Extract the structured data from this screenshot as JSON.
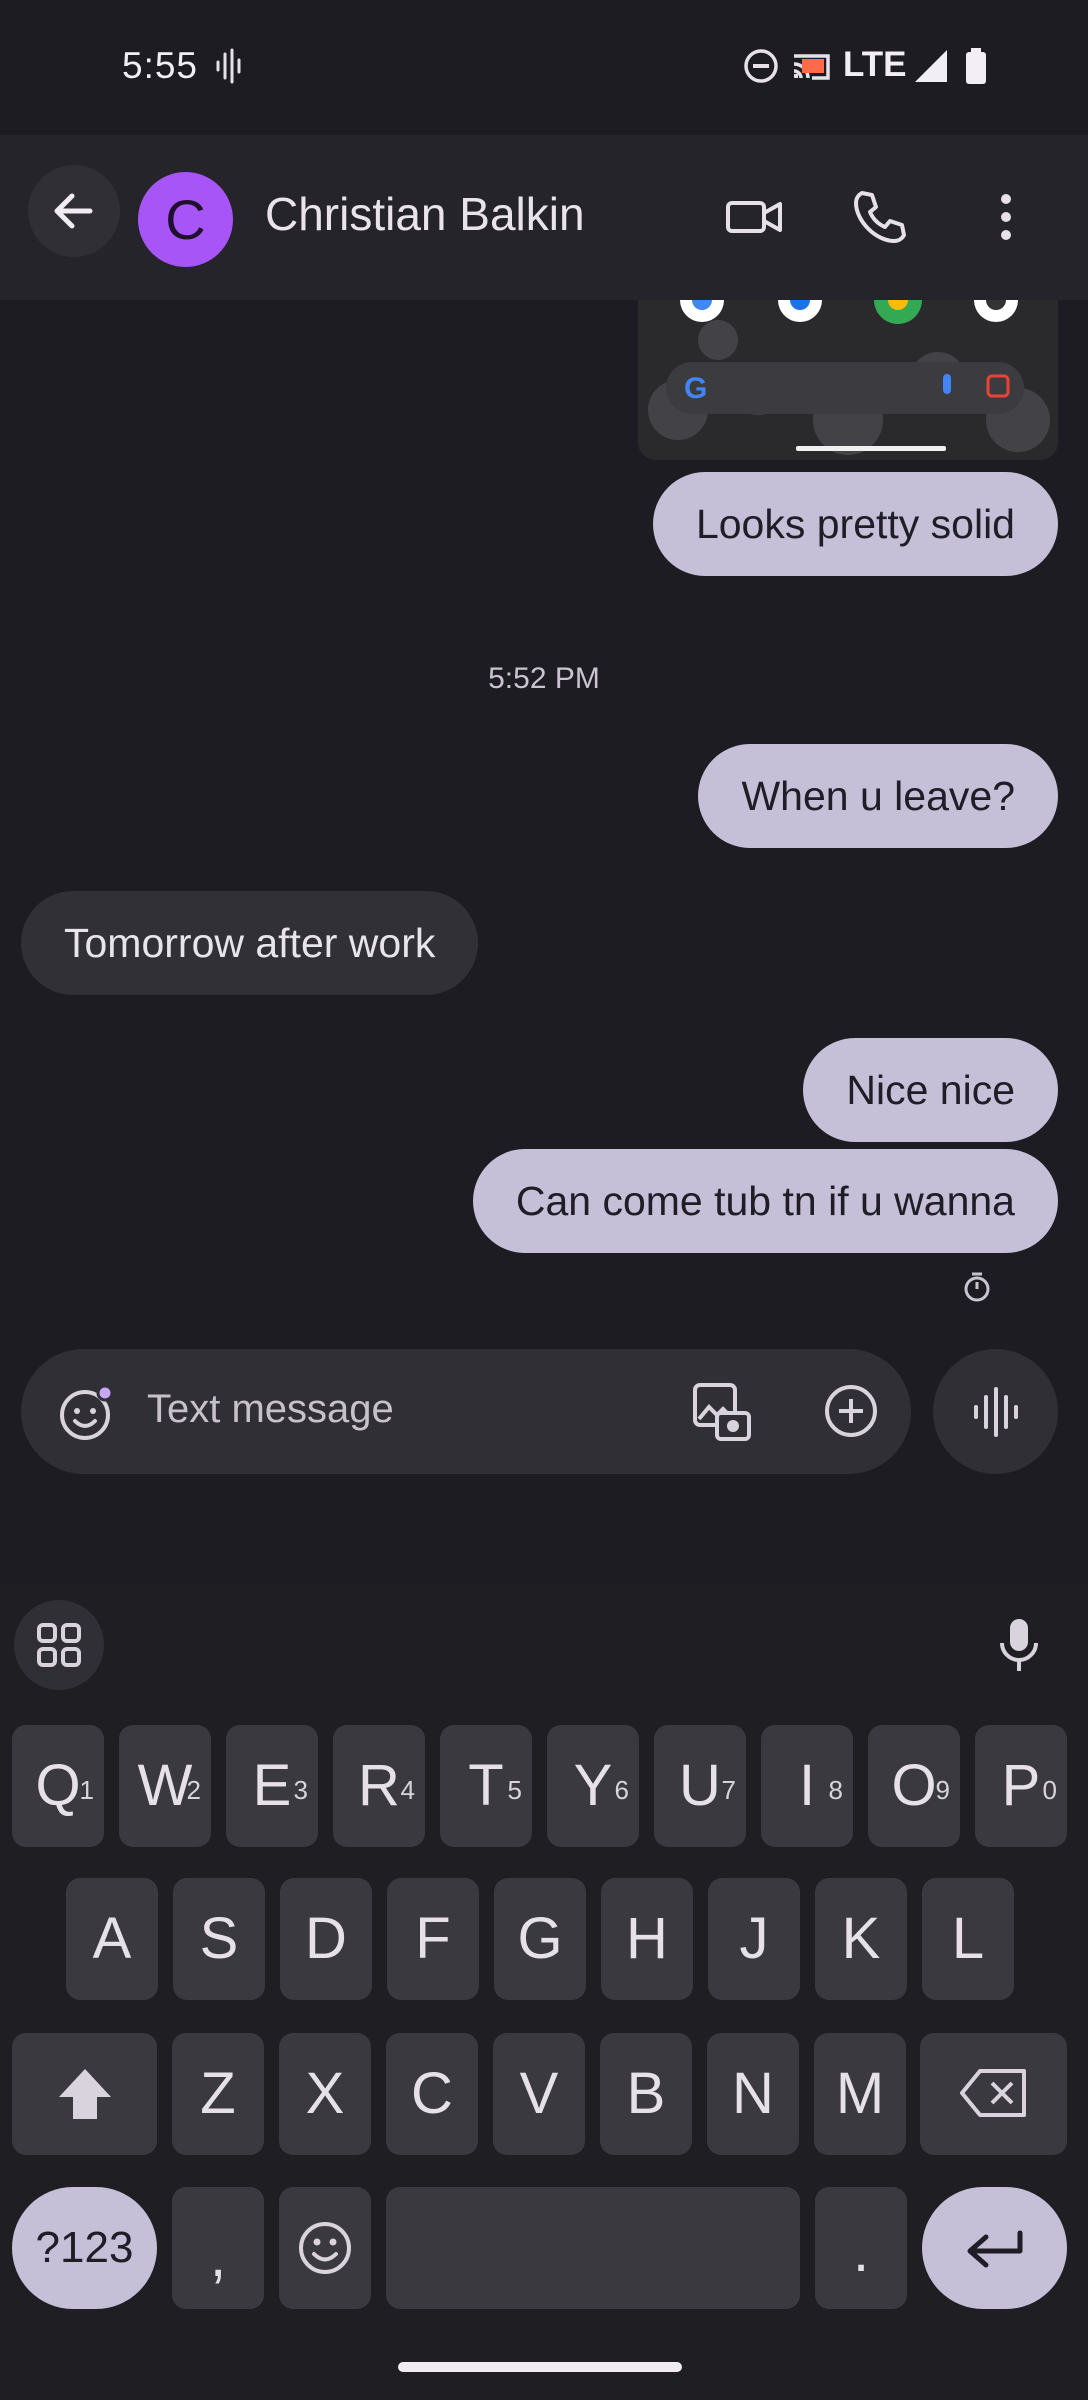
{
  "status_bar": {
    "time": "5:55",
    "network": "LTE"
  },
  "header": {
    "contact_name": "Christian Balkin",
    "avatar_letter": "C"
  },
  "conversation": {
    "messages": [
      {
        "direction": "outgoing",
        "text": "Looks pretty solid"
      },
      {
        "direction": "outgoing",
        "text": "When u leave?"
      },
      {
        "direction": "incoming",
        "text": "Tomorrow after work"
      },
      {
        "direction": "outgoing",
        "text": "Nice nice"
      },
      {
        "direction": "outgoing",
        "text": "Can come tub tn if u wanna"
      }
    ],
    "timestamp": "5:52 PM"
  },
  "composer": {
    "placeholder": "Text message"
  },
  "keyboard": {
    "row1": [
      {
        "k": "Q",
        "h": "1"
      },
      {
        "k": "W",
        "h": "2"
      },
      {
        "k": "E",
        "h": "3"
      },
      {
        "k": "R",
        "h": "4"
      },
      {
        "k": "T",
        "h": "5"
      },
      {
        "k": "Y",
        "h": "6"
      },
      {
        "k": "U",
        "h": "7"
      },
      {
        "k": "I",
        "h": "8"
      },
      {
        "k": "O",
        "h": "9"
      },
      {
        "k": "P",
        "h": "0"
      }
    ],
    "row2": [
      "A",
      "S",
      "D",
      "F",
      "G",
      "H",
      "J",
      "K",
      "L"
    ],
    "row3": [
      "Z",
      "X",
      "C",
      "V",
      "B",
      "N",
      "M"
    ],
    "symbols_label": "?123",
    "comma": ",",
    "period": "."
  },
  "colors": {
    "avatar": "#a855f7",
    "outgoing_bubble": "#c5c0d8",
    "incoming_bubble": "#313036",
    "background": "#1d1c22"
  }
}
